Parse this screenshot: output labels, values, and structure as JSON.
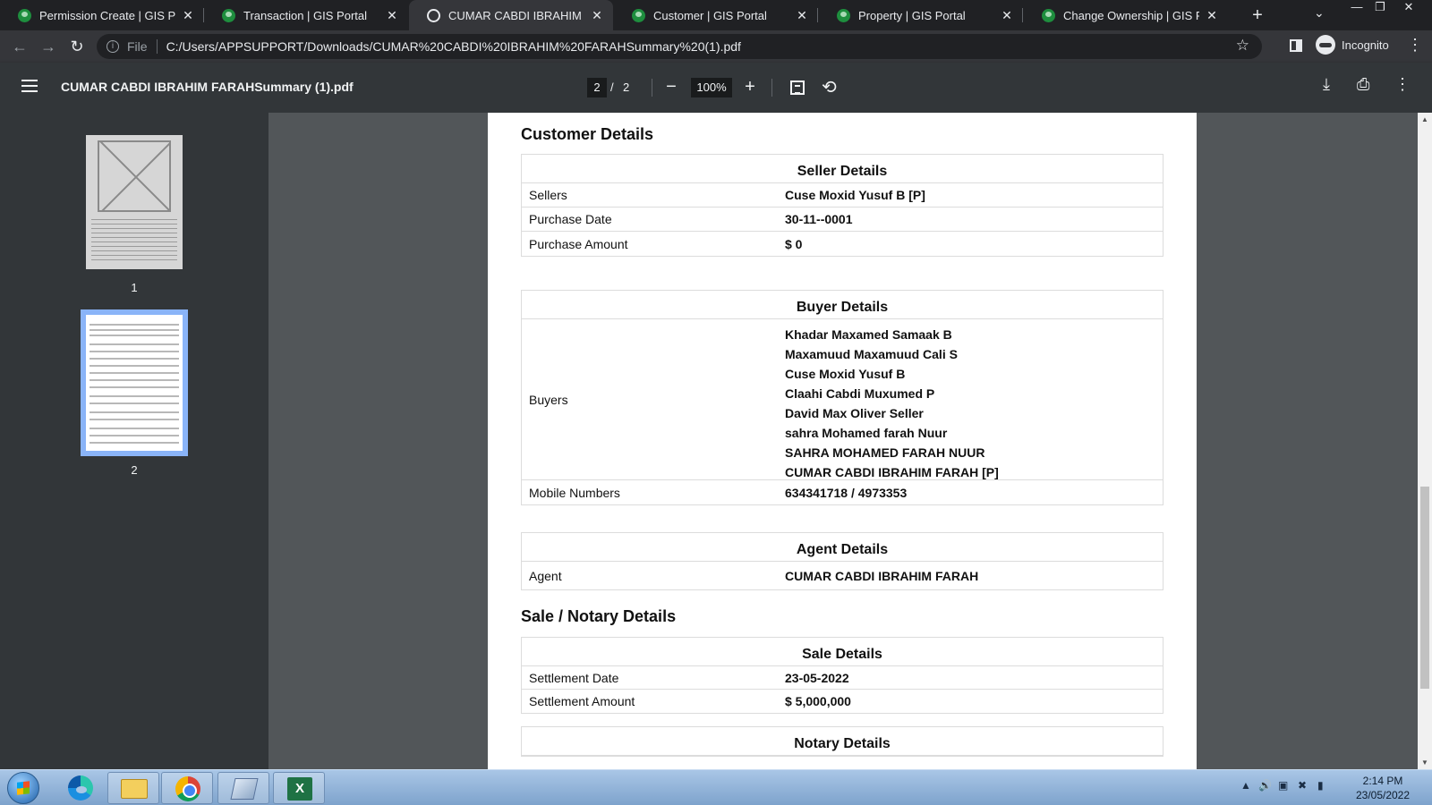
{
  "browser": {
    "tabs": [
      {
        "label": "Permission Create | GIS Portal",
        "active": false,
        "icon": "gis-favicon"
      },
      {
        "label": "Transaction | GIS Portal",
        "active": false,
        "icon": "gis-favicon"
      },
      {
        "label": "CUMAR CABDI IBRAHIM FARAH",
        "active": true,
        "icon": "globe-icon"
      },
      {
        "label": "Customer | GIS Portal",
        "active": false,
        "icon": "gis-favicon"
      },
      {
        "label": "Property | GIS Portal",
        "active": false,
        "icon": "gis-favicon"
      },
      {
        "label": "Change Ownership | GIS Portal",
        "active": false,
        "icon": "gis-favicon"
      }
    ],
    "address": {
      "scheme_label": "File",
      "url": "C:/Users/APPSUPPORT/Downloads/CUMAR%20CABDI%20IBRAHIM%20FARAHSummary%20(1).pdf"
    },
    "profile_label": "Incognito"
  },
  "pdf_toolbar": {
    "title": "CUMAR CABDI IBRAHIM FARAHSummary (1).pdf",
    "current_page": "2",
    "separator": "/",
    "total_pages": "2",
    "zoom": "100%"
  },
  "thumbnails": [
    {
      "number": "1",
      "selected": false
    },
    {
      "number": "2",
      "selected": true
    }
  ],
  "document": {
    "customer_section_title": "Customer Details",
    "seller": {
      "title": "Seller Details",
      "rows": [
        {
          "label": "Sellers",
          "value": "Cuse Moxid Yusuf B [P]"
        },
        {
          "label": "Purchase Date",
          "value": "30-11--0001"
        },
        {
          "label": "Purchase Amount",
          "value": "$ 0"
        }
      ]
    },
    "buyer": {
      "title": "Buyer Details",
      "buyers_label": "Buyers",
      "buyers": [
        "Khadar Maxamed Samaak B",
        "Maxamuud Maxamuud Cali S",
        "Cuse Moxid Yusuf B",
        "Claahi Cabdi Muxumed P",
        "David Max Oliver Seller",
        "sahra Mohamed farah Nuur",
        "SAHRA MOHAMED FARAH NUUR",
        "CUMAR CABDI IBRAHIM FARAH [P]"
      ],
      "mobile_label": "Mobile Numbers",
      "mobile_value": "634341718 / 4973353"
    },
    "agent": {
      "title": "Agent Details",
      "rows": [
        {
          "label": "Agent",
          "value": "CUMAR CABDI IBRAHIM FARAH"
        }
      ]
    },
    "sale_section_title": "Sale / Notary Details",
    "sale": {
      "title": "Sale Details",
      "rows": [
        {
          "label": "Settlement Date",
          "value": "23-05-2022"
        },
        {
          "label": "Settlement Amount",
          "value": "$ 5,000,000"
        }
      ]
    },
    "notary": {
      "title": "Notary Details"
    }
  },
  "taskbar": {
    "apps": [
      "edge-icon",
      "file-explorer-icon",
      "chrome-icon",
      "pen-app-icon",
      "excel-icon"
    ],
    "time": "2:14 PM",
    "date": "23/05/2022"
  },
  "colors": {
    "tab_strip": "#202124",
    "active_tab": "#35363a",
    "pdf_toolbar": "#323639",
    "viewer_background": "#525659",
    "thumbnail_selected": "#8ab4f8",
    "gis_favicon": "#1e8e3e"
  }
}
